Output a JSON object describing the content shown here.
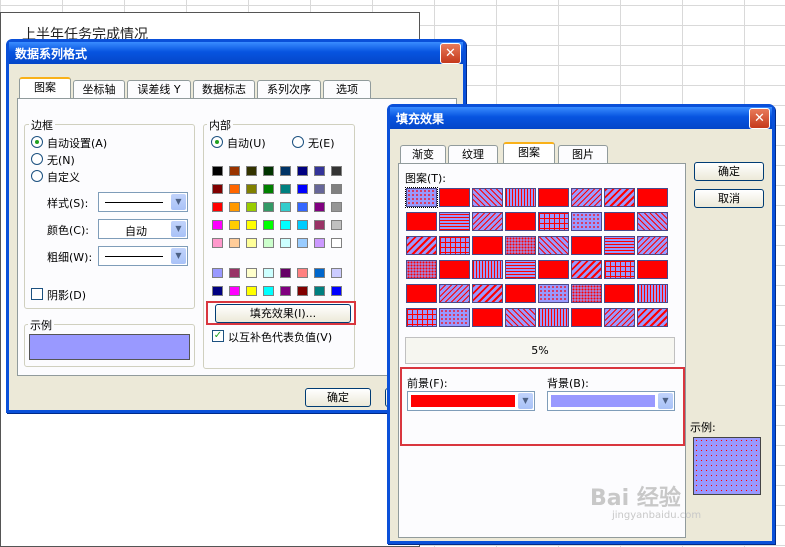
{
  "background": {
    "chart_title": "上半年任务完成情况"
  },
  "format_dialog": {
    "title": "数据系列格式",
    "tabs": [
      "图案",
      "坐标轴",
      "误差线 Y",
      "数据标志",
      "系列次序",
      "选项"
    ],
    "border": {
      "label": "边框",
      "options": [
        "自动设置(A)",
        "无(N)",
        "自定义"
      ],
      "selected": "自动设置(A)",
      "style_label": "样式(S):",
      "color_label": "颜色(C):",
      "color_value": "自动",
      "weight_label": "粗细(W):",
      "shadow_label": "阴影(D)"
    },
    "area": {
      "label": "内部",
      "options": [
        "自动(U)",
        "无(E)"
      ],
      "selected": "自动(U)",
      "palette_main": [
        [
          "#000000",
          "#993300",
          "#333300",
          "#003300",
          "#003366",
          "#000080",
          "#333399",
          "#333333"
        ],
        [
          "#800000",
          "#ff6600",
          "#808000",
          "#008000",
          "#008080",
          "#0000ff",
          "#666699",
          "#808080"
        ],
        [
          "#ff0000",
          "#ff9900",
          "#99cc00",
          "#339966",
          "#33cccc",
          "#3366ff",
          "#800080",
          "#969696"
        ],
        [
          "#ff00ff",
          "#ffcc00",
          "#ffff00",
          "#00ff00",
          "#00ffff",
          "#00ccff",
          "#993366",
          "#c0c0c0"
        ],
        [
          "#ff99cc",
          "#ffcc99",
          "#ffff99",
          "#ccffcc",
          "#ccffff",
          "#99ccff",
          "#cc99ff",
          "#ffffff"
        ]
      ],
      "palette_chart": [
        [
          "#9999ff",
          "#993366",
          "#ffffcc",
          "#ccffff",
          "#660066",
          "#ff8080",
          "#0066cc",
          "#ccccff"
        ],
        [
          "#000080",
          "#ff00ff",
          "#ffff00",
          "#00ffff",
          "#800080",
          "#800000",
          "#008080",
          "#0000ff"
        ]
      ],
      "fill_effects_button": "填充效果(I)...",
      "invert_label": "以互补色代表负值(V)"
    },
    "sample_label": "示例",
    "sample_color": "#9999ff",
    "ok_label": "确定"
  },
  "fill_dialog": {
    "title": "填充效果",
    "tabs": [
      "渐变",
      "纹理",
      "图案",
      "图片"
    ],
    "pattern_label": "图案(T):",
    "pattern_name": "5%",
    "foreground_label": "前景(F):",
    "foreground_color": "#ff0000",
    "background_label": "背景(B):",
    "background_color": "#9999ff",
    "ok_label": "确定",
    "cancel_label": "取消",
    "sample_label": "示例:"
  },
  "watermark": {
    "brand": "Bai 经验",
    "url": "jingyanbaidu.com"
  }
}
